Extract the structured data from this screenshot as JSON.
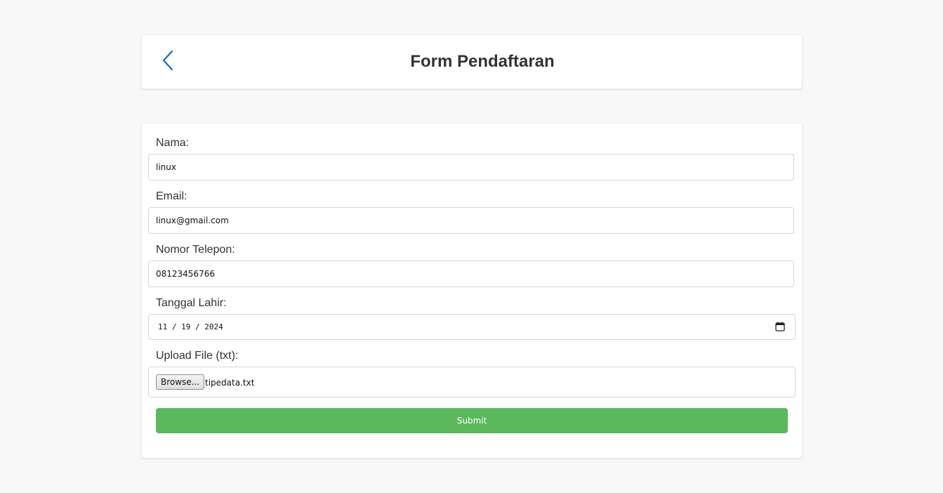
{
  "header": {
    "title": "Form Pendaftaran",
    "back_icon": "chevron-left-icon",
    "accent_color": "#0a6ebd"
  },
  "form": {
    "nama": {
      "label": "Nama:",
      "value": "linux"
    },
    "email": {
      "label": "Email:",
      "value": "linux@gmail.com"
    },
    "telepon": {
      "label": "Nomor Telepon:",
      "value": "08123456766"
    },
    "tanggal": {
      "label": "Tanggal Lahir:",
      "value": "11 / 19 / 2024",
      "icon": "calendar-icon"
    },
    "upload": {
      "label": "Upload File (txt):",
      "button_label": "Browse...",
      "file_name": "tipedata.txt"
    },
    "submit_label": "Submit",
    "submit_color": "#5cb85c"
  }
}
